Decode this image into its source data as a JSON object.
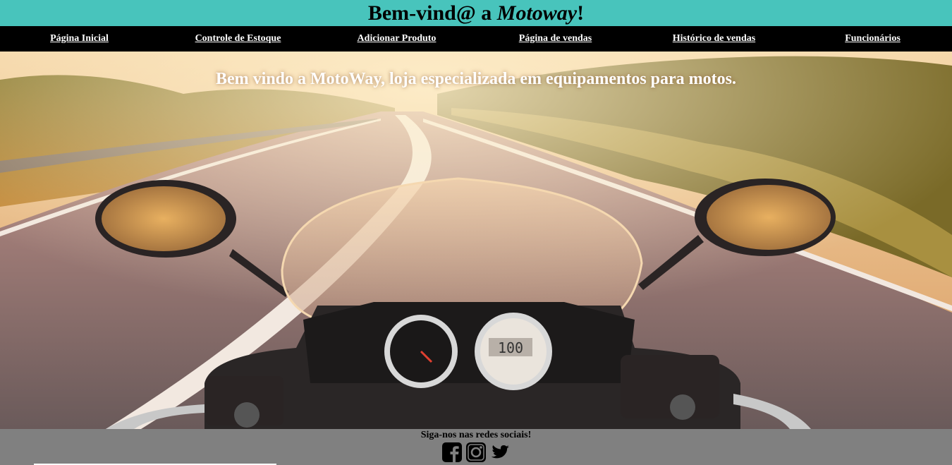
{
  "header": {
    "prefix": "Bem-vind@ a ",
    "brand": "Motoway",
    "suffix": "!"
  },
  "nav": {
    "items": [
      {
        "label": "Página Inicial"
      },
      {
        "label": "Controle de Estoque"
      },
      {
        "label": "Adicionar Produto"
      },
      {
        "label": "Página de vendas"
      },
      {
        "label": "Histórico de vendas"
      },
      {
        "label": "Funcionários"
      }
    ]
  },
  "hero": {
    "welcome": "Bem vindo a MotoWay, loja especializada em equipamentos para motos.",
    "speedometer": "100"
  },
  "footer": {
    "follow": "Siga-nos nas redes sociais!",
    "icons": [
      "facebook-icon",
      "instagram-icon",
      "twitter-icon"
    ]
  },
  "colors": {
    "header_bg": "#48c4bc",
    "nav_bg": "#000000",
    "footer_bg": "#808080"
  }
}
